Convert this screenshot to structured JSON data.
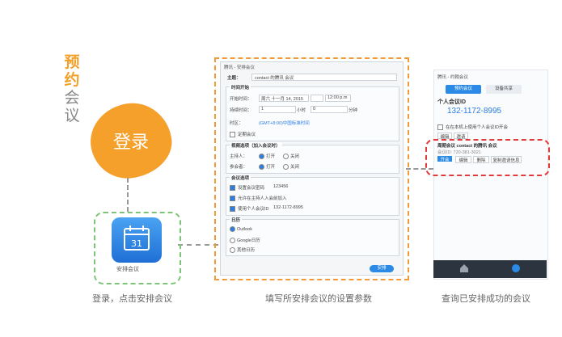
{
  "left": {
    "title_chars_highlight": [
      "预",
      "约"
    ],
    "title_chars_rest": [
      "会",
      "议"
    ],
    "login_label": "登录",
    "app_icon_day": "31",
    "app_name": "安排会议",
    "caption": "登录，点击安排会议"
  },
  "dialog": {
    "window_title": "腾讯 - 安排会议",
    "subject_label": "主题：",
    "subject_value": "contact 的腾讯 会议",
    "time_group": "时间开始",
    "start_label": "开始时间：",
    "start_date": "周六 十一月 14, 2015",
    "start_time": "12:00 p.m",
    "duration_label": "持续时间：",
    "duration_hours": "1",
    "duration_hours_unit": "小时",
    "duration_minutes": "0",
    "duration_minutes_unit": "分钟",
    "timezone_label": "时区：",
    "timezone_value": "(GMT+8:00)中国标准时间",
    "recurring_label": "定期会议",
    "video_group": "视频选项（加入会议时）",
    "host_label": "主持人：",
    "participant_label": "参会者：",
    "on_label": "打开",
    "off_label": "关闭",
    "meeting_group": "会议选项",
    "password_label": "设置会议密码",
    "password_value": "123456",
    "join_before_host": "允许在主持人入会前加入",
    "use_pmi_label": "使用个人会议ID",
    "pmi_value": "132-1172-8995",
    "calendar_group": "日历",
    "calendar_options": [
      "Outlook",
      "Google日历",
      "其他日历"
    ],
    "schedule_button": "安排",
    "caption": "填写所安排会议的设置参数"
  },
  "right": {
    "window_title": "腾讯 - 约翰会议",
    "tab_active": "预约会议",
    "tab_other": "设备共享",
    "pmi_title": "个人会议ID",
    "pmi_number": "132-1172-8995",
    "desktop_option": "在在本机上使用个人会议ID开会",
    "small_btn_1": "编辑",
    "small_btn_2": "邀请",
    "meeting_title": "周期会议  contact 的腾讯 会议",
    "meeting_id": "会议ID: 720-381-3021",
    "action_start": "开会",
    "action_edit": "编辑",
    "action_delete": "删除",
    "action_copy": "复制邀请信息",
    "caption": "查询已安排成功的会议"
  }
}
